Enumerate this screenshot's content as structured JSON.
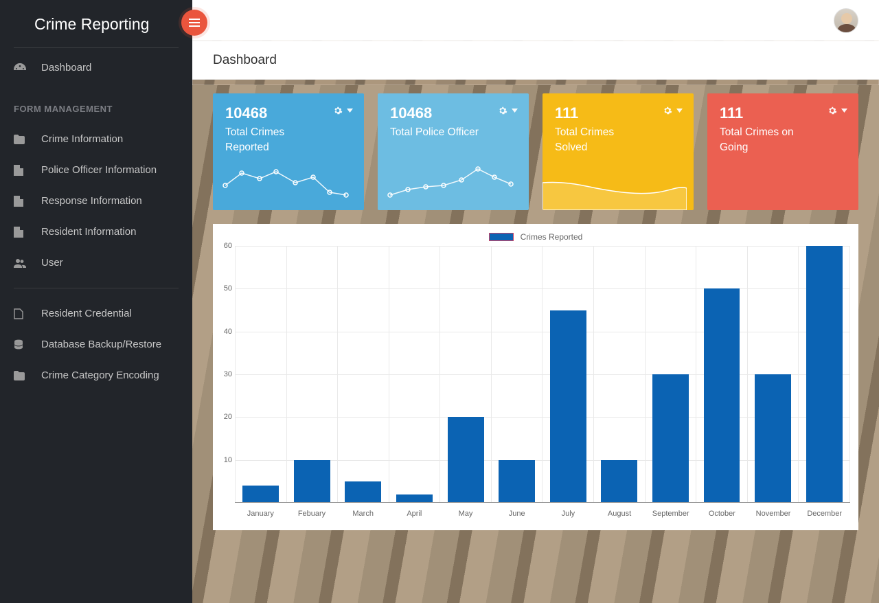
{
  "brand": "Crime Reporting",
  "page_title": "Dashboard",
  "sidebar": {
    "dashboard": "Dashboard",
    "section_form": "FORM MANAGEMENT",
    "items_form": [
      {
        "icon": "folder-icon",
        "label": "Crime Information"
      },
      {
        "icon": "file-icon",
        "label": "Police Officer Information"
      },
      {
        "icon": "file-icon",
        "label": "Response Information"
      },
      {
        "icon": "file-icon",
        "label": "Resident Information"
      },
      {
        "icon": "users-icon",
        "label": "User"
      }
    ],
    "items_other": [
      {
        "icon": "page-icon",
        "label": "Resident Credential"
      },
      {
        "icon": "database-icon",
        "label": "Database Backup/Restore"
      },
      {
        "icon": "folder-icon",
        "label": "Crime Category Encoding"
      }
    ]
  },
  "cards": [
    {
      "value": "10468",
      "label": "Total Crimes Reported",
      "color": "c-blue",
      "spark": "line1"
    },
    {
      "value": "10468",
      "label": "Total Police Officer",
      "color": "c-lblue",
      "spark": "line2"
    },
    {
      "value": "111",
      "label": "Total Crimes Solved",
      "color": "c-yellow",
      "spark": "area"
    },
    {
      "value": "111",
      "label": "Total Crimes on Going",
      "color": "c-red",
      "spark": "none"
    }
  ],
  "chart_data": {
    "type": "bar",
    "title": "",
    "legend": "Crimes Reported",
    "xlabel": "",
    "ylabel": "",
    "ylim": [
      0,
      60
    ],
    "yticks": [
      10,
      20,
      30,
      40,
      50,
      60
    ],
    "categories": [
      "January",
      "Febuary",
      "March",
      "April",
      "May",
      "June",
      "July",
      "August",
      "September",
      "October",
      "November",
      "December"
    ],
    "values": [
      4,
      10,
      5,
      2,
      20,
      10,
      45,
      10,
      30,
      50,
      30,
      60
    ]
  }
}
